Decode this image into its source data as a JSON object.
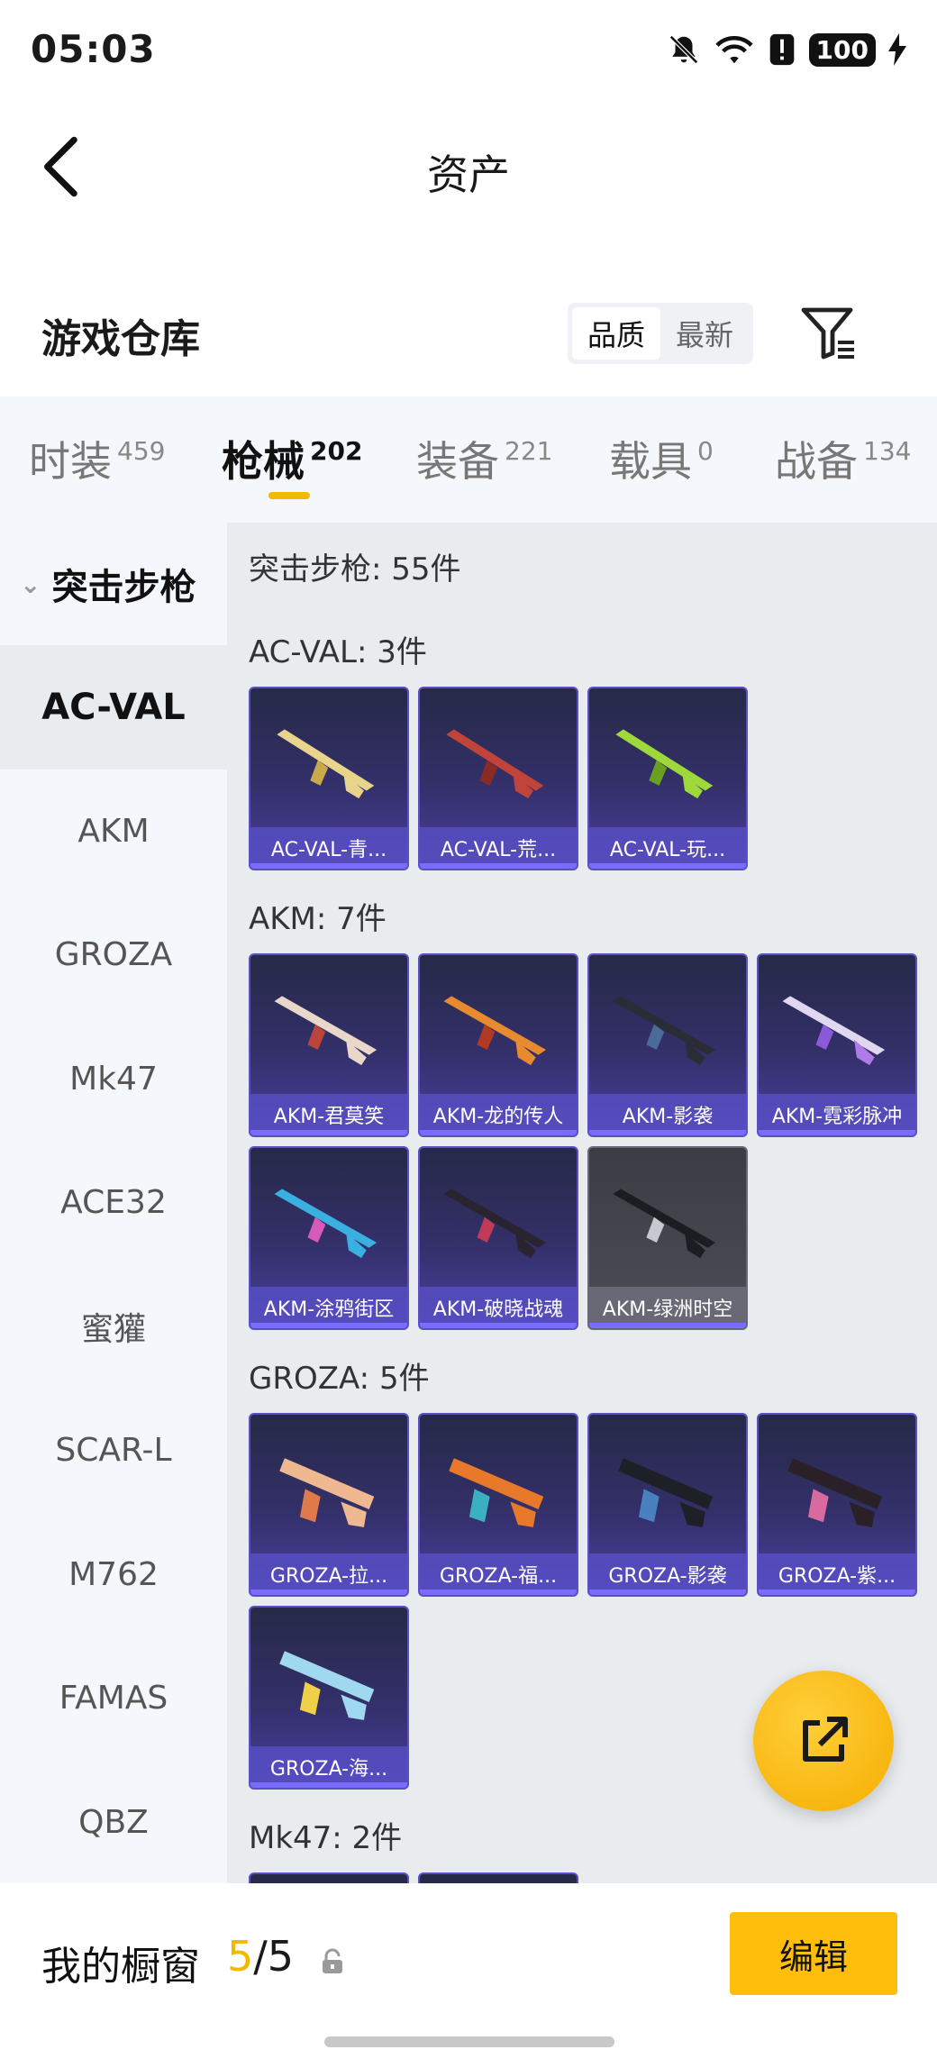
{
  "status_bar": {
    "time": "05:03",
    "battery": "100"
  },
  "header": {
    "title": "资产"
  },
  "section": {
    "title": "游戏仓库",
    "sort_options": [
      "品质",
      "最新"
    ],
    "sort_active": "品质"
  },
  "tabs": [
    {
      "label": "时装",
      "count": "459"
    },
    {
      "label": "枪械",
      "count": "202"
    },
    {
      "label": "装备",
      "count": "221"
    },
    {
      "label": "载具",
      "count": "0"
    },
    {
      "label": "战备",
      "count": "134"
    }
  ],
  "active_tab": "枪械",
  "side_nav": {
    "group": "突击步枪",
    "items": [
      "AC-VAL",
      "AKM",
      "GROZA",
      "Mk47",
      "ACE32",
      "蜜獾",
      "SCAR-L",
      "M762",
      "FAMAS",
      "QBZ"
    ],
    "active": "AC-VAL"
  },
  "content": {
    "category_header": "突击步枪: 55件",
    "groups": [
      {
        "header": "AC-VAL: 3件",
        "items": [
          "AC-VAL-青...",
          "AC-VAL-荒...",
          "AC-VAL-玩..."
        ]
      },
      {
        "header": "AKM: 7件",
        "items": [
          "AKM-君莫笑",
          "AKM-龙的传人",
          "AKM-影袭",
          "AKM-霓彩脉冲",
          "AKM-涂鸦街区",
          "AKM-破晓战魂",
          "AKM-绿洲时空"
        ]
      },
      {
        "header": "GROZA: 5件",
        "items": [
          "GROZA-拉...",
          "GROZA-福...",
          "GROZA-影袭",
          "GROZA-紫...",
          "GROZA-海..."
        ]
      },
      {
        "header": "Mk47: 2件",
        "items": []
      }
    ]
  },
  "bottom": {
    "showcase_label": "我的橱窗",
    "current": "5",
    "total": "/5",
    "edit_label": "编辑"
  },
  "colors": {
    "accent": "#f5b800",
    "card_purple": "#4a3fa0",
    "nav_bg": "#f4f7fb"
  }
}
